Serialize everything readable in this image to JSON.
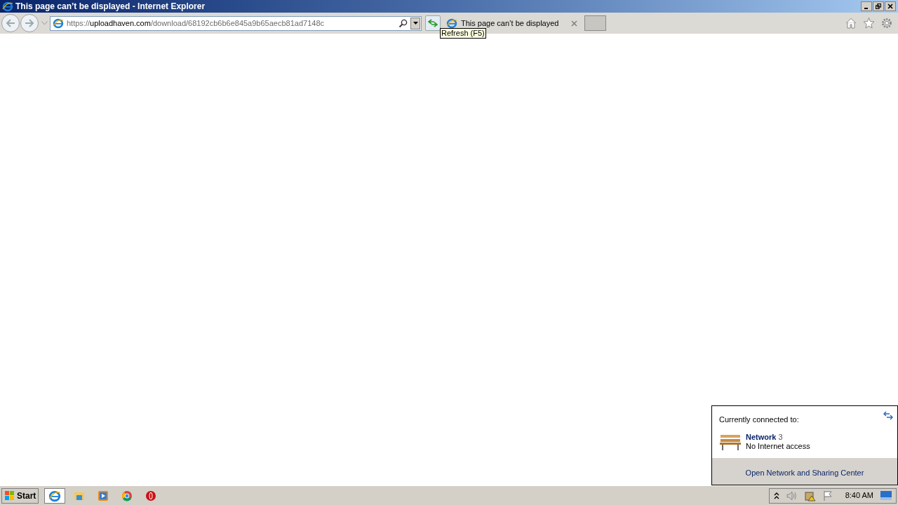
{
  "window": {
    "title": "This page can’t be displayed - Internet Explorer"
  },
  "address_bar": {
    "scheme": "https://",
    "host": "uploadhaven.com",
    "path": "/download/68192cb6b6e845a9b65aecb81ad7148c"
  },
  "tab": {
    "title": "This page can’t be displayed"
  },
  "tooltip": "Refresh (F5)",
  "network_popup": {
    "heading": "Currently connected to:",
    "network_name": "Network",
    "network_number": "3",
    "network_status": "No Internet access",
    "link": "Open Network and Sharing Center"
  },
  "taskbar": {
    "start": "Start",
    "apps": [
      {
        "kind": "ie",
        "selected": true
      },
      {
        "kind": "explorer",
        "selected": false
      },
      {
        "kind": "media",
        "selected": false
      },
      {
        "kind": "chrome",
        "selected": false
      },
      {
        "kind": "opera",
        "selected": false
      }
    ],
    "clock": "8:40 AM"
  }
}
